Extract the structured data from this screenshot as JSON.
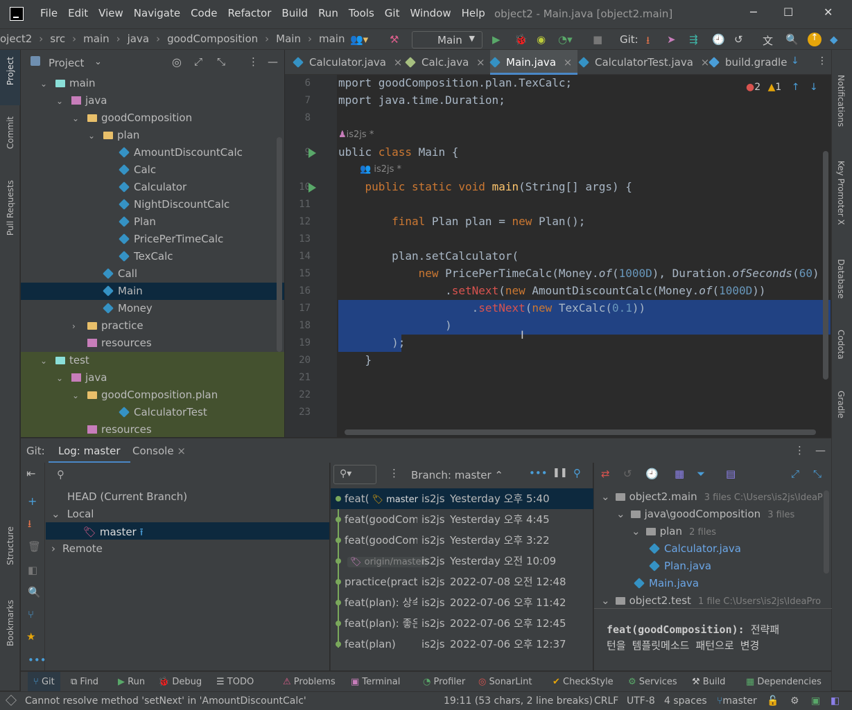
{
  "titlebar": {
    "menu": [
      "File",
      "Edit",
      "View",
      "Navigate",
      "Code",
      "Refactor",
      "Build",
      "Run",
      "Tools",
      "Git",
      "Window",
      "Help"
    ],
    "title": "object2 - Main.java [object2.main]"
  },
  "navbar": {
    "crumbs": [
      "oject2",
      "src",
      "main",
      "java",
      "goodComposition",
      "Main",
      "main"
    ],
    "run_config": "Main",
    "git_label": "Git:"
  },
  "left_strip": {
    "project": "Project",
    "commit": "Commit",
    "pull_requests": "Pull Requests",
    "structure": "Structure",
    "bookmarks": "Bookmarks"
  },
  "right_strip": {
    "notifications": "Notifications",
    "key_promoter": "Key Promoter X",
    "database": "Database",
    "codota": "Codota",
    "gradle": "Gradle"
  },
  "project": {
    "title": "Project",
    "tree": [
      {
        "label": "main",
        "indent": 0,
        "arrow": "⌄",
        "icon": "module-folder"
      },
      {
        "label": "java",
        "indent": 1,
        "arrow": "⌄",
        "icon": "source-root"
      },
      {
        "label": "goodComposition",
        "indent": 2,
        "arrow": "⌄",
        "icon": "package"
      },
      {
        "label": "plan",
        "indent": 3,
        "arrow": "⌄",
        "icon": "package"
      },
      {
        "label": "AmountDiscountCalc",
        "indent": 4,
        "icon": "class"
      },
      {
        "label": "Calc",
        "indent": 4,
        "icon": "class"
      },
      {
        "label": "Calculator",
        "indent": 4,
        "icon": "class"
      },
      {
        "label": "NightDiscountCalc",
        "indent": 4,
        "icon": "class"
      },
      {
        "label": "Plan",
        "indent": 4,
        "icon": "class"
      },
      {
        "label": "PricePerTimeCalc",
        "indent": 4,
        "icon": "class"
      },
      {
        "label": "TexCalc",
        "indent": 4,
        "icon": "class"
      },
      {
        "label": "Call",
        "indent": 3,
        "icon": "class"
      },
      {
        "label": "Main",
        "indent": 3,
        "icon": "class",
        "selected": true
      },
      {
        "label": "Money",
        "indent": 3,
        "icon": "class"
      },
      {
        "label": "practice",
        "indent": 2,
        "arrow": "›",
        "icon": "package"
      },
      {
        "label": "resources",
        "indent": 2,
        "icon": "resources"
      },
      {
        "label": "test",
        "indent": 0,
        "arrow": "⌄",
        "icon": "module-folder"
      },
      {
        "label": "java",
        "indent": 1,
        "arrow": "⌄",
        "icon": "source-root"
      },
      {
        "label": "goodComposition.plan",
        "indent": 2,
        "arrow": "⌄",
        "icon": "package"
      },
      {
        "label": "CalculatorTest",
        "indent": 4,
        "icon": "class"
      },
      {
        "label": "resources",
        "indent": 2,
        "icon": "resources"
      }
    ]
  },
  "editor": {
    "tabs": [
      {
        "label": "Calculator.java",
        "close": "×"
      },
      {
        "label": "Calc.java",
        "close": "×"
      },
      {
        "label": "Main.java",
        "close": "×",
        "active": true
      },
      {
        "label": "CalculatorTest.java",
        "close": "×"
      },
      {
        "label": "build.gradle"
      }
    ],
    "inspections": {
      "errors": "2",
      "warnings": "1"
    },
    "author_hint": "is2js *",
    "lines": [
      {
        "n": "6",
        "html": "mport goodComposition.plan.TexCalc;"
      },
      {
        "n": "7",
        "html": "mport java.time.Duration;"
      },
      {
        "n": "8",
        "html": ""
      },
      {
        "n": "9",
        "html": "ublic class Main {"
      },
      {
        "n": "10",
        "html": "    public static void main(String[] args) {"
      },
      {
        "n": "11",
        "html": ""
      },
      {
        "n": "12",
        "html": "        final Plan plan = new Plan();"
      },
      {
        "n": "13",
        "html": ""
      },
      {
        "n": "14",
        "html": "        plan.setCalculator("
      },
      {
        "n": "15",
        "html": "            new PricePerTimeCalc(Money.of(1000D), Duration.ofSeconds(60)"
      },
      {
        "n": "16",
        "html": "                .setNext(new AmountDiscountCalc(Money.of(1000D))"
      },
      {
        "n": "17",
        "html": "                    .setNext(new TexCalc(0.1))"
      },
      {
        "n": "18",
        "html": "                )"
      },
      {
        "n": "19",
        "html": "        );"
      },
      {
        "n": "20",
        "html": "    }"
      },
      {
        "n": "21",
        "html": ""
      },
      {
        "n": "22",
        "html": ""
      },
      {
        "n": "23",
        "html": ""
      }
    ]
  },
  "bottom": {
    "tabs": {
      "git": "Git:",
      "log": "Log: master",
      "console": "Console"
    },
    "branches": {
      "head": "HEAD (Current Branch)",
      "local": "Local",
      "master": "master",
      "remote": "Remote"
    },
    "branch_filter": "Branch: master",
    "commits": [
      {
        "msg": "feat(",
        "tag": "master",
        "author": "is2js",
        "date": "Yesterday 오후 5:40",
        "selected": true
      },
      {
        "msg": "feat(goodComp",
        "author": "is2js",
        "date": "Yesterday 오후 4:45"
      },
      {
        "msg": "feat(goodComp",
        "author": "is2js",
        "date": "Yesterday 오후 3:22"
      },
      {
        "msg": "",
        "tag": "origin/master",
        "author": "is2js",
        "date": "Yesterday 오전 10:09"
      },
      {
        "msg": "practice(practice",
        "author": "is2js",
        "date": "2022-07-08 오전 12:48"
      },
      {
        "msg": "feat(plan): 상속",
        "author": "is2js",
        "date": "2022-07-06 오후 11:42"
      },
      {
        "msg": "feat(plan): 좋은",
        "author": "is2js",
        "date": "2022-07-06 오후 12:45"
      },
      {
        "msg": "feat(plan)",
        "author": "is2js",
        "date": "2022-07-06 오후 12:37"
      }
    ],
    "changes": [
      {
        "label": "object2.main",
        "meta": "3 files  C:\\Users\\is2js\\IdeaP",
        "indent": 0,
        "arrow": "⌄"
      },
      {
        "label": "java\\goodComposition",
        "meta": "3 files",
        "indent": 1,
        "arrow": "⌄"
      },
      {
        "label": "plan",
        "meta": "2 files",
        "indent": 2,
        "arrow": "⌄"
      },
      {
        "label": "Calculator.java",
        "meta": "",
        "indent": 3
      },
      {
        "label": "Plan.java",
        "meta": "",
        "indent": 3
      },
      {
        "label": "Main.java",
        "meta": "",
        "indent": 2
      },
      {
        "label": "object2.test",
        "meta": "1 file  C:\\Users\\is2js\\IdeaPro",
        "indent": 0,
        "arrow": "⌄"
      }
    ],
    "commit_message_bold": "feat(goodComposition):",
    "commit_message_rest": " 전략패",
    "commit_message_line2": "턴을 템플릿메소드 패턴으로 변경"
  },
  "toolwindows": [
    "Git",
    "Find",
    "Run",
    "Debug",
    "TODO",
    "Problems",
    "Terminal",
    "Profiler",
    "SonarLint",
    "CheckStyle",
    "Services",
    "Build",
    "Dependencies"
  ],
  "status": {
    "message": "Cannot resolve method 'setNext' in 'AmountDiscountCalc'",
    "position": "19:11 (53 chars, 2 line breaks)",
    "line_sep": "CRLF",
    "encoding": "UTF-8",
    "indent": "4 spaces",
    "branch": "master"
  }
}
